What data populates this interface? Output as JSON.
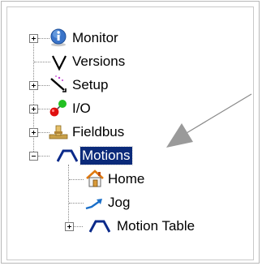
{
  "tree": {
    "nodes": [
      {
        "label": "Monitor",
        "icon": "info-icon",
        "expander": "plus"
      },
      {
        "label": "Versions",
        "icon": "versions-v-icon",
        "expander": "none"
      },
      {
        "label": "Setup",
        "icon": "setup-wand-icon",
        "expander": "plus"
      },
      {
        "label": "I/O",
        "icon": "io-pins-icon",
        "expander": "plus"
      },
      {
        "label": "Fieldbus",
        "icon": "fieldbus-icon",
        "expander": "plus"
      },
      {
        "label": "Motions",
        "icon": "motion-profile-icon",
        "expander": "minus",
        "selected": true
      },
      {
        "label": "Home",
        "icon": "home-icon",
        "expander": "none"
      },
      {
        "label": "Jog",
        "icon": "jog-arrow-icon",
        "expander": "none"
      },
      {
        "label": "Motion Table",
        "icon": "motion-profile-icon",
        "expander": "plus"
      }
    ]
  },
  "colors": {
    "selection_bg": "#0b2a7a",
    "selection_text": "#ffffff",
    "motion_icon": "#0b2a8a",
    "callout_arrow": "#9a9a9a"
  }
}
